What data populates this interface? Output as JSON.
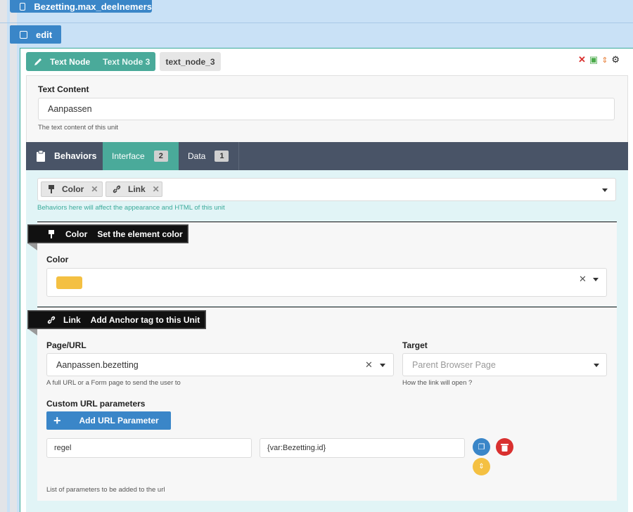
{
  "containers": {
    "top_tag": "Bezetting.max_deelnemers",
    "edit_tag": "edit"
  },
  "node": {
    "type_label": "Text Node",
    "name_label": "Text Node 3",
    "id_label": "text_node_3"
  },
  "text_content": {
    "label": "Text Content",
    "value": "Aanpassen",
    "help": "The text content of this unit"
  },
  "tabs": [
    {
      "label": "Behaviors"
    },
    {
      "label": "Interface",
      "count": "2"
    },
    {
      "label": "Data",
      "count": "1"
    }
  ],
  "behaviors": {
    "chips": [
      "Color",
      "Link"
    ],
    "help": "Behaviors here will affect the appearance and HTML of this unit"
  },
  "color_behavior": {
    "name": "Color",
    "description": "Set the element color",
    "field_label": "Color",
    "swatch": "#f4c042"
  },
  "link_behavior": {
    "name": "Link",
    "description": "Add Anchor tag to this Unit",
    "page_label": "Page/URL",
    "page_value": "Aanpassen.bezetting",
    "page_help": "A full URL or a Form page to send the user to",
    "target_label": "Target",
    "target_placeholder": "Parent Browser Page",
    "target_help": "How the link will open ?",
    "params_label": "Custom URL parameters",
    "add_param_label": "Add URL Parameter",
    "param_key": "regel",
    "param_value": "{var:Bezetting.id}",
    "params_help": "List of parameters to be added to the url"
  },
  "colors": {
    "teal": "#4aaa9a",
    "tab_bar": "#495467",
    "blue": "#3a86c8",
    "red": "#d9302f",
    "yellow": "#f4c042"
  }
}
